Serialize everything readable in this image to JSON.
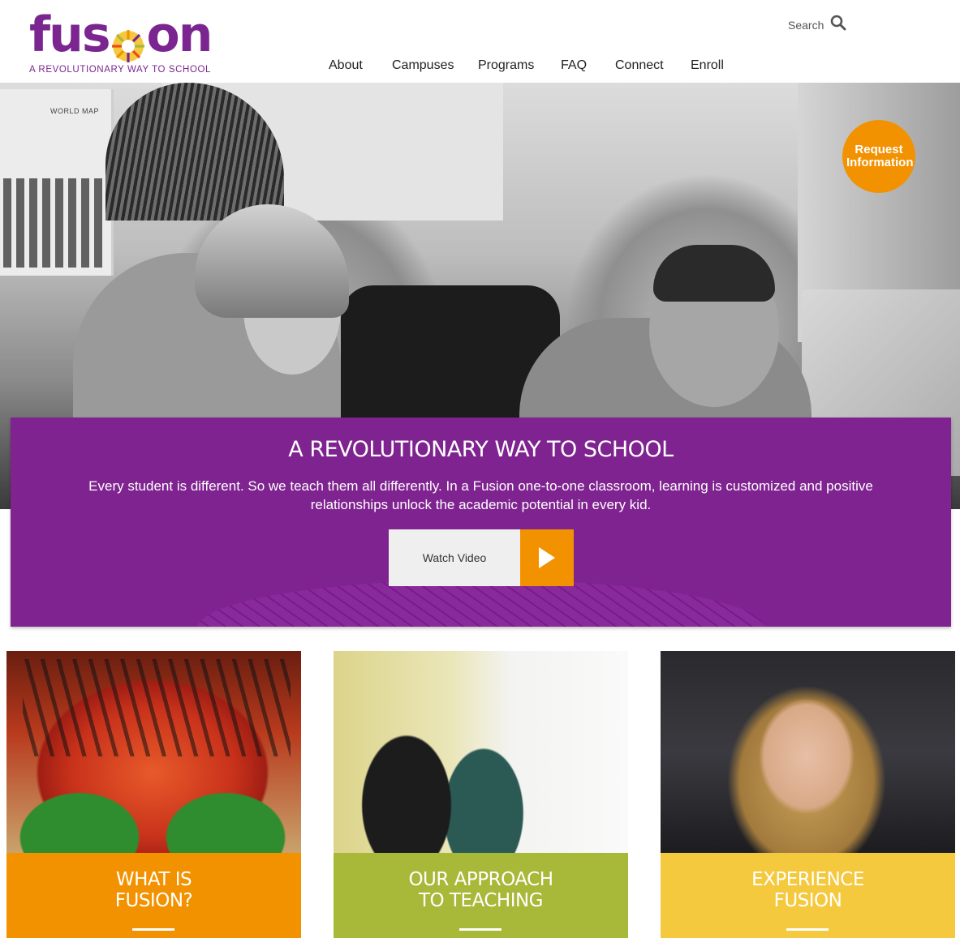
{
  "brand": {
    "logo_left": "fus",
    "logo_right": "on",
    "tagline": "A REVOLUTIONARY WAY TO SCHOOL"
  },
  "search": {
    "label": "Search",
    "icon": "search-icon"
  },
  "nav": [
    "About",
    "Campuses",
    "Programs",
    "FAQ",
    "Connect",
    "Enroll"
  ],
  "hero": {
    "request_info": "Request Information",
    "map_label": "WORLD MAP"
  },
  "band": {
    "title": "A REVOLUTIONARY WAY TO SCHOOL",
    "text": "Every student is different. So we teach them all differently. In a Fusion one-to-one classroom, learning is customized and positive relationships unlock the academic potential in every kid.",
    "video_label": "Watch Video",
    "video_icon": "play-icon"
  },
  "cards": [
    {
      "line1": "WHAT IS",
      "line2": "FUSION?",
      "color": "#f39200"
    },
    {
      "line1": "OUR APPROACH",
      "line2": "TO TEACHING",
      "color": "#a8b838"
    },
    {
      "line1": "EXPERIENCE",
      "line2": "FUSION",
      "color": "#f5c93e"
    }
  ],
  "colors": {
    "brand_purple": "#7b2590",
    "band_purple": "#7f2390",
    "orange": "#f39200"
  }
}
